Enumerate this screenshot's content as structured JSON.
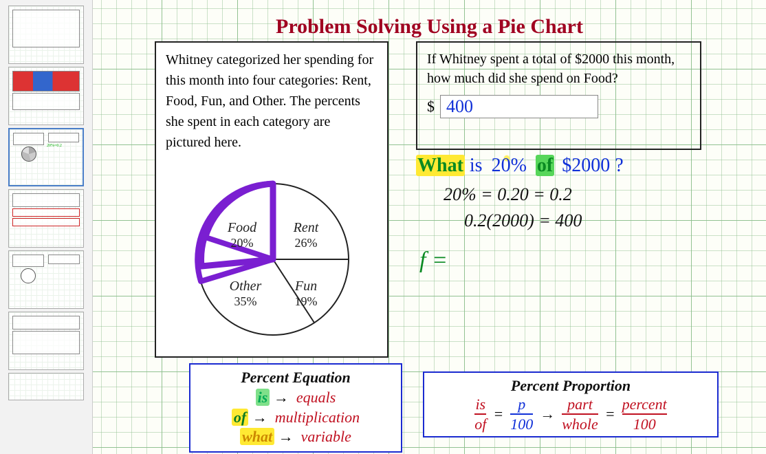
{
  "title": "Problem Solving Using a Pie Chart",
  "problem_text": "Whitney categorized her spending for this month into four categories: Rent, Food, Fun, and Other. The percents she spent in each category are pictured here.",
  "question_text": "If Whitney spent a total of $2000 this month, how much did she spend on Food?",
  "answer_currency": "$",
  "answer_value": "400",
  "chart_data": {
    "type": "pie",
    "title": "",
    "slices": [
      {
        "name": "Food",
        "percent": 20,
        "highlighted": true
      },
      {
        "name": "Rent",
        "percent": 26
      },
      {
        "name": "Fun",
        "percent": 19
      },
      {
        "name": "Other",
        "percent": 35
      }
    ]
  },
  "handwriting": {
    "line1": {
      "what": "What",
      "is": "is",
      "pct": "20%",
      "of": "of",
      "amt": "$2000",
      "q": "?"
    },
    "line2": "20% = 0.20 = 0.2",
    "line3": "0.2(2000) = 400",
    "var_f": "f  ="
  },
  "percent_equation": {
    "title": "Percent Equation",
    "r1_kw": "is",
    "r1_val": "equals",
    "r2_kw": "of",
    "r2_val": "multiplication",
    "r3_kw": "what",
    "r3_val": "variable",
    "arrow": "→"
  },
  "percent_proportion": {
    "title": "Percent Proportion",
    "is": "is",
    "of": "of",
    "p": "p",
    "hundred": "100",
    "part": "part",
    "whole": "whole",
    "percent": "percent",
    "eq": "=",
    "arrow": "→"
  },
  "pie_labels": {
    "food": "Food",
    "food_pct": "20%",
    "rent": "Rent",
    "rent_pct": "26%",
    "fun": "Fun",
    "fun_pct": "19%",
    "other": "Other",
    "other_pct": "35%"
  }
}
